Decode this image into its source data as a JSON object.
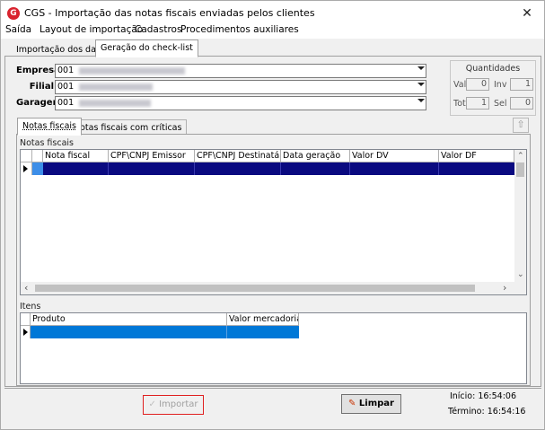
{
  "window": {
    "title": "CGS - Importação das notas fiscais enviadas pelos clientes",
    "app_icon": "G"
  },
  "menu": [
    "Saída",
    "Layout de importação",
    "Cadastros",
    "Procedimentos auxiliares"
  ],
  "outer_tabs": [
    "Importação dos dados",
    "Geração do check-list"
  ],
  "form": {
    "empresa_label": "Empresa",
    "empresa_code": "001",
    "filial_label": "Filial",
    "filial_code": "001",
    "garagem_label": "Garagem",
    "garagem_code": "001"
  },
  "quantidades": {
    "title": "Quantidades",
    "val_label": "Val",
    "val": "0",
    "inv_label": "Inv",
    "inv": "1",
    "tot_label": "Tot",
    "tot": "1",
    "sel_label": "Sel",
    "sel": "0"
  },
  "inner_tabs": [
    "Notas fiscais",
    "Notas fiscais com críticas"
  ],
  "notas": {
    "group_label": "Notas fiscais",
    "columns": [
      "Nota fiscal",
      "CPF\\CNPJ Emissor",
      "CPF\\CNPJ Destinatário",
      "Data geração",
      "Valor DV",
      "Valor DF"
    ]
  },
  "itens": {
    "group_label": "Itens",
    "columns": [
      "Produto",
      "Valor mercadoria"
    ]
  },
  "buttons": {
    "importar": "Importar",
    "limpar": "Limpar"
  },
  "times": {
    "inicio_label": "Início:",
    "inicio": "16:54:06",
    "termino_label": "Término:",
    "termino": "16:54:16"
  },
  "colors": {
    "selection": "#0a0a80",
    "accent_blue": "#0078d7",
    "highlight_red": "#e02020"
  }
}
